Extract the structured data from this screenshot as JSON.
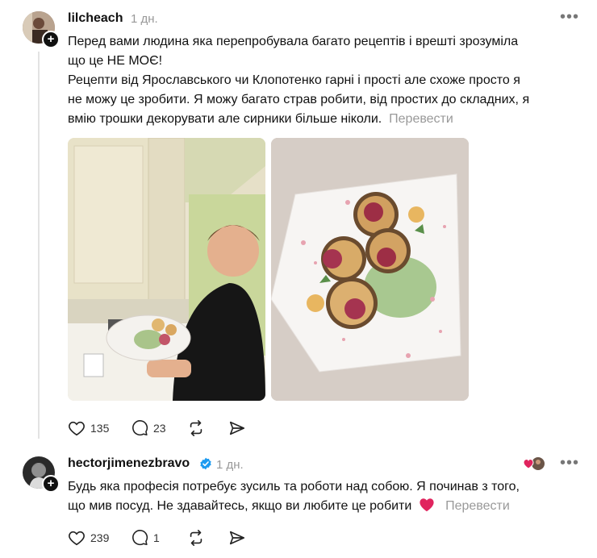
{
  "post": {
    "username": "lilcheach",
    "time": "1 дн.",
    "more_icon": "more-horizontal-icon",
    "text_lines": [
      "Перед вами людина яка перепробувала багато рецептів і врешті зрозуміла",
      "що це НЕ МОЄ!",
      "Рецепти від Ярославського чи Клопотенко гарні і прості але схоже просто я",
      "не можу це зробити. Я можу багато страв робити, від простих до складних, я",
      "вмію трошки декорувати але сирники більше ніколи."
    ],
    "translate": "Перевести",
    "actions": {
      "likes": "135",
      "comments": "23"
    }
  },
  "reply": {
    "username": "hectorjimenezbravo",
    "verified": true,
    "time": "1 дн.",
    "text_lines": [
      "Будь яка професія потребує зусиль та роботи над собою. Я починав з того,",
      "що мив посуд. Не здавайтесь, якщо ви любите це робити"
    ],
    "translate": "Перевести",
    "actions": {
      "likes": "239",
      "comments": "1"
    }
  },
  "colors": {
    "verified": "#1d9bf0",
    "heart": "#e0245e",
    "muted": "#999999"
  }
}
